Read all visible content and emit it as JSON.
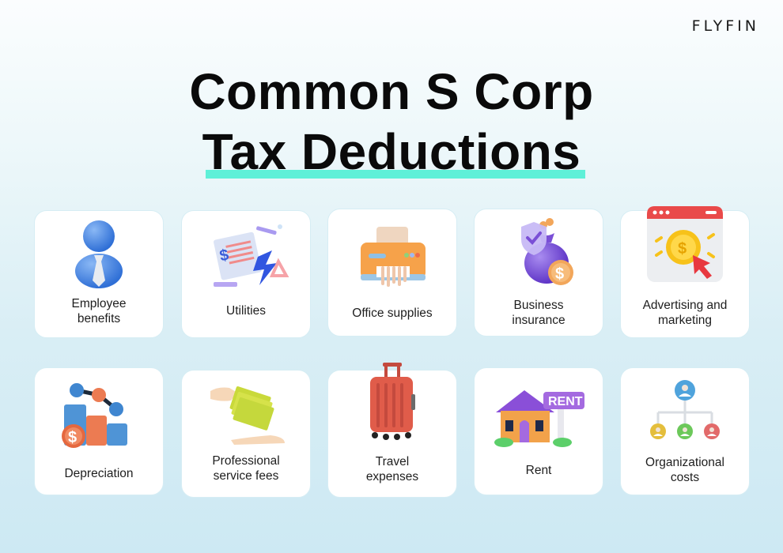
{
  "brand": {
    "logo": "FLYFIN"
  },
  "header": {
    "title_line1": "Common S Corp",
    "title_line2": "Tax Deductions",
    "highlight_color": "#5ff0d8"
  },
  "cards": [
    {
      "label": "Employee\nbenefits",
      "icon": "employee-icon"
    },
    {
      "label": "Utilities",
      "icon": "utility-bill-icon"
    },
    {
      "label": "Office supplies",
      "icon": "shredder-icon"
    },
    {
      "label": "Business\ninsurance",
      "icon": "money-bag-shield-icon"
    },
    {
      "label": "Advertising and\nmarketing",
      "icon": "browser-coin-click-icon"
    },
    {
      "label": "Depreciation",
      "icon": "bar-chart-decline-icon"
    },
    {
      "label": "Professional\nservice fees",
      "icon": "hand-paying-icon"
    },
    {
      "label": "Travel\nexpenses",
      "icon": "suitcase-icon"
    },
    {
      "label": "Rent",
      "icon": "house-rent-sign-icon",
      "sign_text": "RENT"
    },
    {
      "label": "Organizational\ncosts",
      "icon": "org-chart-icon"
    }
  ]
}
